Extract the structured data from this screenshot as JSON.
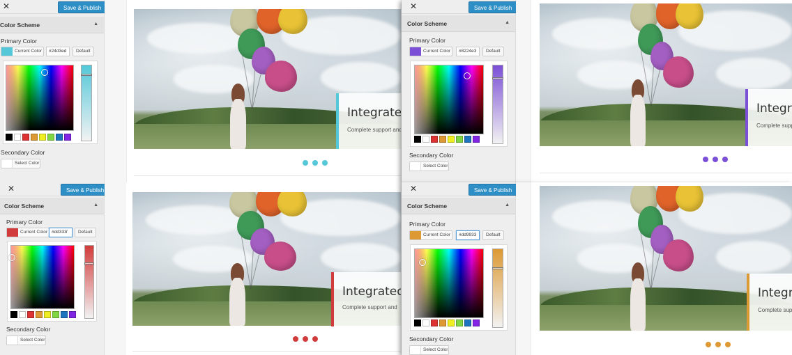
{
  "toolbar": {
    "close_label": "✕",
    "save_label": "Save & Publish"
  },
  "section": {
    "title": "Color Scheme"
  },
  "primary": {
    "label": "Primary Color",
    "current_label": "Current Color",
    "default_label": "Default"
  },
  "secondary": {
    "label": "Secondary Color",
    "select_label": "Select Color"
  },
  "caption": {
    "title": "Integrated",
    "subtitle": "Complete support and"
  },
  "variants": [
    {
      "accent": "#54c8d8",
      "hex": "#24d3ed"
    },
    {
      "accent": "#7b4fd6",
      "hex": "#8224e3"
    },
    {
      "accent": "#d23b3b",
      "hex": "#dd333̸"
    },
    {
      "accent": "#dd9933",
      "hex": "#dd9933"
    }
  ],
  "palette_colors": [
    "#000000",
    "#ffffff",
    "#dd3333",
    "#dd9933",
    "#eeee22",
    "#81d742",
    "#1e73be",
    "#8224e3"
  ]
}
